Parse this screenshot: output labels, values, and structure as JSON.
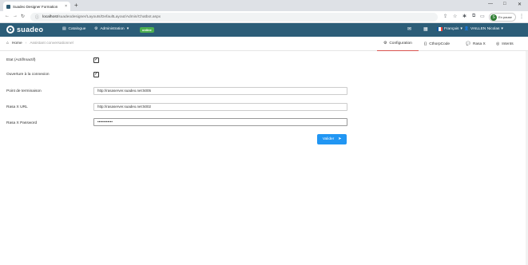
{
  "browser": {
    "tab_title": "Suadeo Designer Formation",
    "tab_close": "×",
    "new_tab": "+",
    "url_host": "localhost",
    "url_path": "/suadeodesigner/Layouts/DefaultLayout/Admin/Chatbot.aspx",
    "profile_initial": "S",
    "profile_label": "En pause",
    "win_min": "—",
    "win_max": "□",
    "win_close": "✕"
  },
  "header": {
    "logo_text": "suadeo",
    "menu_catalogue": "Catalogue",
    "menu_admin": "Administration",
    "online_badge": "online",
    "language": "Français",
    "user": "VAILLEN Nicolas",
    "flag_colors": [
      "#0055a4",
      "#ffffff",
      "#ef4135"
    ]
  },
  "breadcrumb": {
    "home": "Home",
    "sep": "›",
    "current": "Assistant conversationnel"
  },
  "subtabs": {
    "configuration": "Configuration",
    "cthorp": "CthorpCode",
    "rasa": "Rasa X",
    "intents": "Intents"
  },
  "form": {
    "etat_label": "Etat (Actif/Inactif)",
    "etat_checked": true,
    "ouverture_label": "Ouverture à la connexion",
    "ouverture_checked": true,
    "endpoint_label": "Point de terminaison",
    "endpoint_value": "http://rasaserver.suadeo.net:5005",
    "rasa_url_label": "Rasa X URL",
    "rasa_url_value": "http://rasaserver.suadeo.net:5002",
    "rasa_pwd_label": "Rasa X Password",
    "rasa_pwd_value": "••••••••••••",
    "submit_label": "Valider"
  },
  "colors": {
    "header_bg": "#2c5d78",
    "accent_red": "#d9534f",
    "button_blue": "#2196f3",
    "online_green": "#4caf50"
  }
}
